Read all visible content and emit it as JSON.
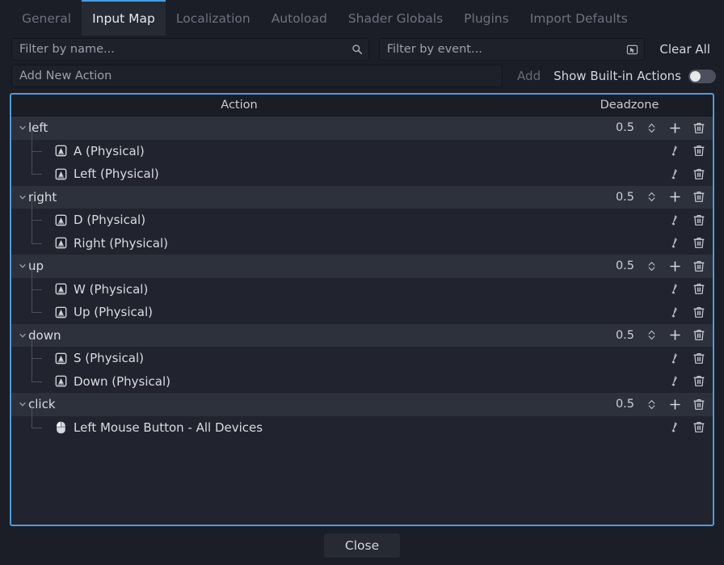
{
  "colors": {
    "dialog_bg": "#1b1e26",
    "tree_bg": "#21242e",
    "action_row_bg": "#2d313c",
    "accent": "#4d9bdd",
    "text": "#d4d6dd",
    "muted_text": "#6d7280"
  },
  "tabs": [
    {
      "label": "General",
      "active": false
    },
    {
      "label": "Input Map",
      "active": true
    },
    {
      "label": "Localization",
      "active": false
    },
    {
      "label": "Autoload",
      "active": false
    },
    {
      "label": "Shader Globals",
      "active": false
    },
    {
      "label": "Plugins",
      "active": false
    },
    {
      "label": "Import Defaults",
      "active": false
    }
  ],
  "filters": {
    "name_placeholder": "Filter by name...",
    "name_value": "",
    "name_icon": "search-icon",
    "event_placeholder": "Filter by event...",
    "event_value": "",
    "event_icon": "event-capture-icon",
    "clear_all_label": "Clear All"
  },
  "add_action": {
    "placeholder": "Add New Action",
    "value": "",
    "add_label": "Add",
    "add_enabled": false,
    "show_builtin_label": "Show Built-in Actions",
    "show_builtin_enabled": false
  },
  "table": {
    "col_action": "Action",
    "col_deadzone": "Deadzone"
  },
  "actions": [
    {
      "name": "left",
      "deadzone": "0.5",
      "expanded": true,
      "events": [
        {
          "label": "A (Physical)",
          "icon": "keyboard-key-icon"
        },
        {
          "label": "Left (Physical)",
          "icon": "keyboard-key-icon"
        }
      ]
    },
    {
      "name": "right",
      "deadzone": "0.5",
      "expanded": true,
      "events": [
        {
          "label": "D (Physical)",
          "icon": "keyboard-key-icon"
        },
        {
          "label": "Right (Physical)",
          "icon": "keyboard-key-icon"
        }
      ]
    },
    {
      "name": "up",
      "deadzone": "0.5",
      "expanded": true,
      "events": [
        {
          "label": "W (Physical)",
          "icon": "keyboard-key-icon"
        },
        {
          "label": "Up (Physical)",
          "icon": "keyboard-key-icon"
        }
      ]
    },
    {
      "name": "down",
      "deadzone": "0.5",
      "expanded": true,
      "events": [
        {
          "label": "S (Physical)",
          "icon": "keyboard-key-icon"
        },
        {
          "label": "Down (Physical)",
          "icon": "keyboard-key-icon"
        }
      ]
    },
    {
      "name": "click",
      "deadzone": "0.5",
      "expanded": true,
      "events": [
        {
          "label": "Left Mouse Button - All Devices",
          "icon": "mouse-icon"
        }
      ]
    }
  ],
  "row_icons": {
    "add_event": "plus-icon",
    "delete": "trash-icon",
    "edit_event": "pencil-icon"
  },
  "footer": {
    "close_label": "Close"
  }
}
